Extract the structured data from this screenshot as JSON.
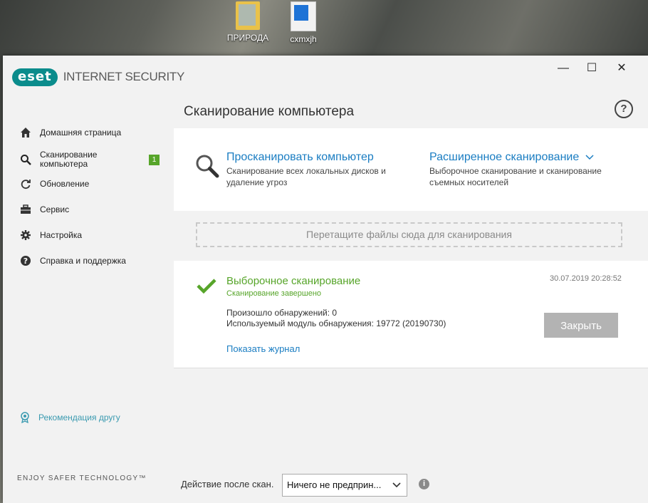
{
  "desktop": {
    "icons": [
      {
        "label": "ПРИРОДА",
        "icon": "folder-icon"
      },
      {
        "label": "cxmxjh",
        "icon": "document-icon"
      }
    ]
  },
  "window": {
    "logo_badge": "eset",
    "product_name": "INTERNET SECURITY",
    "controls": {
      "minimize": "—",
      "maximize": "☐",
      "close": "✕"
    }
  },
  "sidebar": {
    "items": [
      {
        "label": "Домашняя страница",
        "icon": "home-icon"
      },
      {
        "label": "Сканирование компьютера",
        "icon": "search-icon",
        "badge": "1"
      },
      {
        "label": "Обновление",
        "icon": "refresh-icon"
      },
      {
        "label": "Сервис",
        "icon": "toolbox-icon"
      },
      {
        "label": "Настройка",
        "icon": "gear-icon"
      },
      {
        "label": "Справка и поддержка",
        "icon": "help-icon"
      }
    ],
    "recommend": "Рекомендация другу",
    "tagline": "ENJOY SAFER TECHNOLOGY™"
  },
  "main": {
    "title": "Сканирование компьютера",
    "help": "?",
    "scan_computer": {
      "title": "Просканировать компьютер",
      "desc_line1": "Сканирование всех локальных дисков и",
      "desc_line2": "удаление угроз"
    },
    "advanced_scan": {
      "title": "Расширенное сканирование",
      "desc_line1": "Выборочное сканирование и сканирование",
      "desc_line2": "съемных носителей"
    },
    "dropzone": "Перетащите файлы сюда для сканирования",
    "result": {
      "title": "Выборочное сканирование",
      "status": "Сканирование завершено",
      "timestamp": "30.07.2019 20:28:52",
      "detections": "Произошло обнаружений: 0",
      "module": "Используемый модуль обнаружения: 19772 (20190730)",
      "show_log": "Показать журнал",
      "close": "Закрыть"
    },
    "footer": {
      "label": "Действие после скан.",
      "select_value": "Ничего не предприн...",
      "info": "i"
    }
  },
  "colors": {
    "accent_green": "#57a52a",
    "link_blue": "#1a7dc2",
    "eset_teal": "#0b8c8c"
  }
}
